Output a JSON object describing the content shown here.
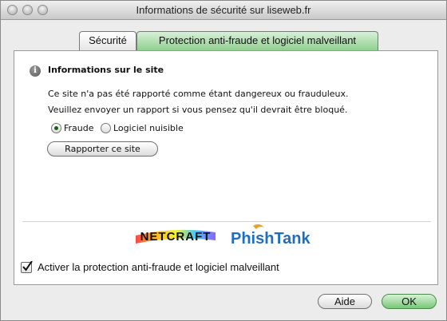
{
  "window": {
    "title": "Informations de sécurité sur liseweb.fr"
  },
  "tabs": [
    {
      "label": "Sécurité"
    },
    {
      "label": "Protection anti-fraude et logiciel malveillant",
      "active": true
    }
  ],
  "panel": {
    "info_title": "Informations sur le site",
    "line1": "Ce site n'a pas été rapporté comme étant dangereux ou frauduleux.",
    "line2": "Veuillez envoyer un rapport si vous pensez qu'il devrait être bloqué.",
    "radio_fraud": "Fraude",
    "radio_malware": "Logiciel nuisible",
    "report_button": "Rapporter ce site",
    "logo_netcraft": "NETCRAFT",
    "logo_phishtank": "PhishTank",
    "checkbox_label": "Activer la protection anti-fraude et logiciel malveillant"
  },
  "buttons": {
    "help": "Aide",
    "ok": "OK"
  },
  "colors": {
    "accent_green": "#8fd08f",
    "ok_green": "#77c777"
  }
}
